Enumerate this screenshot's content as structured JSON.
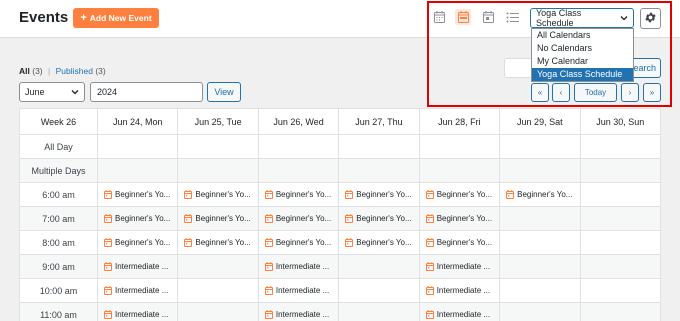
{
  "header": {
    "title": "Events",
    "add_button": "Add New Event"
  },
  "toolbar": {
    "view_icons": [
      "month-view-icon",
      "week-view-icon",
      "day-view-icon",
      "list-view-icon"
    ],
    "active_view": "week-view-icon",
    "calendar_select": "Yoga Class Schedule",
    "calendar_options": [
      "All Calendars",
      "No Calendars",
      "My Calendar",
      "Yoga Class Schedule"
    ],
    "selected_option_index": 3
  },
  "filters": {
    "all_label": "All",
    "all_count": "(3)",
    "separator": "|",
    "published_label": "Published",
    "published_count": "(3)"
  },
  "controls": {
    "month": "June",
    "year": "2024",
    "view_button": "View",
    "search_button": "Search",
    "search_button_visible": "earch",
    "nav_first": "«",
    "nav_prev": "‹",
    "nav_today": "Today",
    "nav_next": "›",
    "nav_last": "»"
  },
  "grid": {
    "columns": [
      "Week 26",
      "Jun 24, Mon",
      "Jun 25, Tue",
      "Jun 26, Wed",
      "Jun 27, Thu",
      "Jun 28, Fri",
      "Jun 29, Sat",
      "Jun 30, Sun"
    ],
    "rows": [
      {
        "label": "All Day",
        "cells": [
          "",
          "",
          "",
          "",
          "",
          "",
          ""
        ]
      },
      {
        "label": "Multiple Days",
        "cells": [
          "",
          "",
          "",
          "",
          "",
          "",
          ""
        ]
      },
      {
        "label": "6:00 am",
        "cells": [
          "Beginner's Yo...",
          "Beginner's Yo...",
          "Beginner's Yo...",
          "Beginner's Yo...",
          "Beginner's Yo...",
          "Beginner's Yo...",
          ""
        ]
      },
      {
        "label": "7:00 am",
        "cells": [
          "Beginner's Yo...",
          "Beginner's Yo...",
          "Beginner's Yo...",
          "Beginner's Yo...",
          "Beginner's Yo...",
          "",
          ""
        ]
      },
      {
        "label": "8:00 am",
        "cells": [
          "Beginner's Yo...",
          "Beginner's Yo...",
          "Beginner's Yo...",
          "Beginner's Yo...",
          "Beginner's Yo...",
          "",
          ""
        ]
      },
      {
        "label": "9:00 am",
        "cells": [
          "Intermediate ...",
          "",
          "Intermediate ...",
          "",
          "Intermediate ...",
          "",
          ""
        ]
      },
      {
        "label": "10:00 am",
        "cells": [
          "Intermediate ...",
          "",
          "Intermediate ...",
          "",
          "Intermediate ...",
          "",
          ""
        ]
      },
      {
        "label": "11:00 am",
        "cells": [
          "Intermediate ...",
          "",
          "Intermediate ...",
          "",
          "Intermediate ...",
          "",
          ""
        ]
      }
    ]
  },
  "colors": {
    "accent": "#ff7f3f",
    "link": "#2271b1",
    "highlight_box": "#e00000",
    "event_icon": "#ff7f3f"
  }
}
